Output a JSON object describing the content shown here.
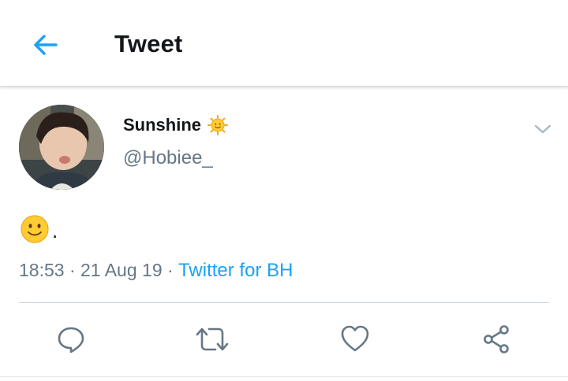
{
  "header": {
    "title": "Tweet",
    "back_icon": "arrow-left-icon"
  },
  "tweet": {
    "author": {
      "display_name": "Sunshine",
      "name_emoji": "sun-face-emoji",
      "handle": "@Hobiee_"
    },
    "body": {
      "emoji": "slightly-smiling-face-emoji",
      "text": "."
    },
    "time": "18:53",
    "separator": "·",
    "date": "21 Aug 19",
    "source": "Twitter for BH",
    "menu_icon": "chevron-down-icon"
  },
  "actions": [
    {
      "name": "reply",
      "icon": "reply-icon"
    },
    {
      "name": "retweet",
      "icon": "retweet-icon"
    },
    {
      "name": "like",
      "icon": "heart-icon"
    },
    {
      "name": "share",
      "icon": "share-icon"
    }
  ],
  "colors": {
    "accent": "#1da1f2",
    "text": "#14171a",
    "secondary_text": "#657786",
    "icon_gray": "#657786"
  }
}
